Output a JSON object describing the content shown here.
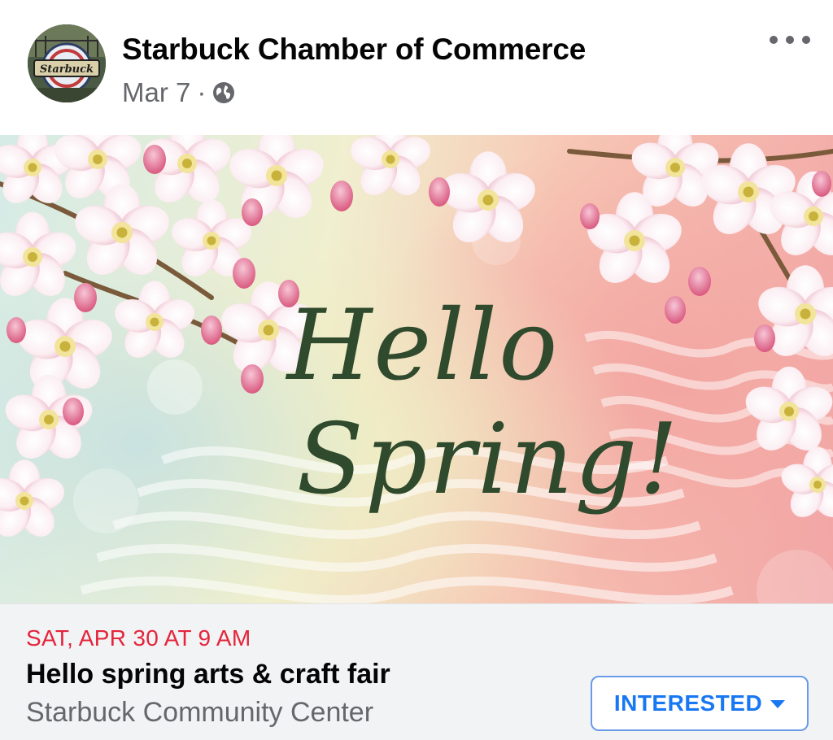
{
  "post": {
    "page_name": "Starbuck Chamber of Commerce",
    "date": "Mar 7",
    "separator": "·",
    "avatar_text": "Starbuck",
    "audience_icon": "globe-icon",
    "more_icon": "more-options-icon"
  },
  "hero": {
    "greeting_line1": "Hello",
    "greeting_line2": "Spring!"
  },
  "event": {
    "date_time": "SAT, APR 30 AT 9 AM",
    "title": "Hello spring arts & craft fair",
    "location": "Starbuck Community Center",
    "interested_label": "INTERESTED",
    "interested_icon": "caret-down-icon"
  },
  "colors": {
    "event_date": "#e4243b",
    "accent_blue": "#1877f2",
    "secondary_text": "#65676b",
    "script_text": "#2f4a2c"
  }
}
